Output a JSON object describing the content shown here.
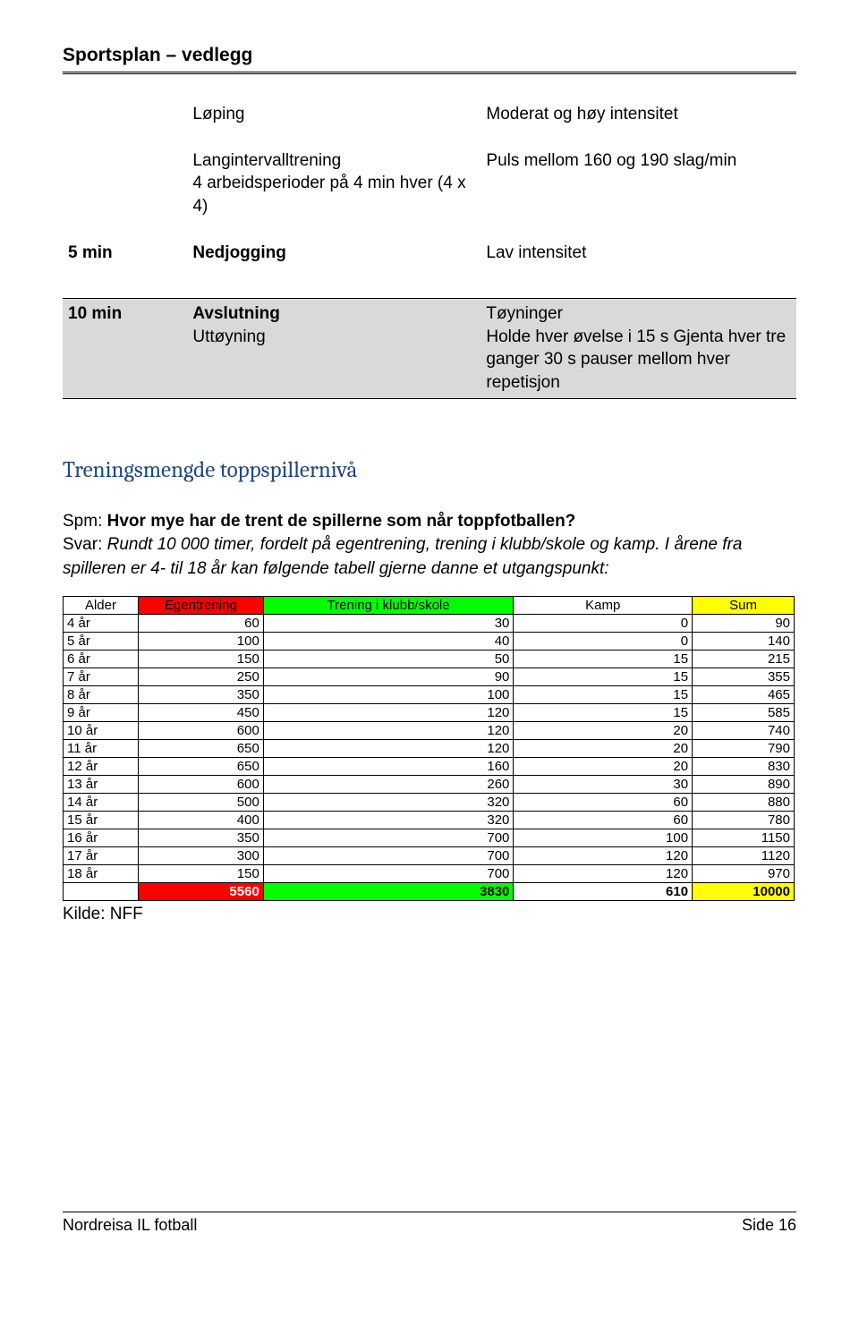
{
  "header": {
    "title": "Sportsplan – vedlegg"
  },
  "activity_table": {
    "r1c2a": "Løping",
    "r1c3": "Moderat og høy intensitet",
    "r2c2a": "Langintervalltrening",
    "r2c2b": "4 arbeidsperioder på 4 min hver (4 x 4)",
    "r2c3": "Puls mellom 160 og 190 slag/min",
    "r3c1a": "5 min",
    "r3c2a": "Nedjogging",
    "r3c3": "Lav intensitet",
    "r4c1a": "10 min",
    "r4c2a": "Avslutning",
    "r4c2b": "Uttøyning",
    "r4c3": "Tøyninger\nHolde hver øvelse i 15 s Gjenta hver tre ganger 30 s pauser mellom hver repetisjon"
  },
  "section_title": "Treningsmengde toppspillernivå",
  "qa": {
    "spm_label": "Spm:",
    "spm_text": "Hvor mye har de trent de spillerne som når toppfotballen?",
    "svar_label": "Svar:",
    "svar_text": "Rundt 10 000 timer, fordelt på egentrening, trening i klubb/skole og kamp. I årene fra spilleren er 4- til 18 år kan følgende tabell gjerne danne et utgangspunkt:"
  },
  "chart_data": {
    "type": "table",
    "title": "",
    "columns": [
      "Alder",
      "Egentrening",
      "Trening i klubb/skole",
      "Kamp",
      "Sum"
    ],
    "rows": [
      [
        "4 år",
        60,
        30,
        0,
        90
      ],
      [
        "5 år",
        100,
        40,
        0,
        140
      ],
      [
        "6 år",
        150,
        50,
        15,
        215
      ],
      [
        "7 år",
        250,
        90,
        15,
        355
      ],
      [
        "8 år",
        350,
        100,
        15,
        465
      ],
      [
        "9 år",
        450,
        120,
        15,
        585
      ],
      [
        "10 år",
        600,
        120,
        20,
        740
      ],
      [
        "11 år",
        650,
        120,
        20,
        790
      ],
      [
        "12 år",
        650,
        160,
        20,
        830
      ],
      [
        "13 år",
        600,
        260,
        30,
        890
      ],
      [
        "14 år",
        500,
        320,
        60,
        880
      ],
      [
        "15 år",
        400,
        320,
        60,
        780
      ],
      [
        "16 år",
        350,
        700,
        100,
        1150
      ],
      [
        "17 år",
        300,
        700,
        120,
        1120
      ],
      [
        "18 år",
        150,
        700,
        120,
        970
      ]
    ],
    "totals": [
      "",
      5560,
      3830,
      610,
      10000
    ]
  },
  "kilde": "Kilde: NFF",
  "footer": {
    "left": "Nordreisa IL fotball",
    "right": "Side 16"
  }
}
